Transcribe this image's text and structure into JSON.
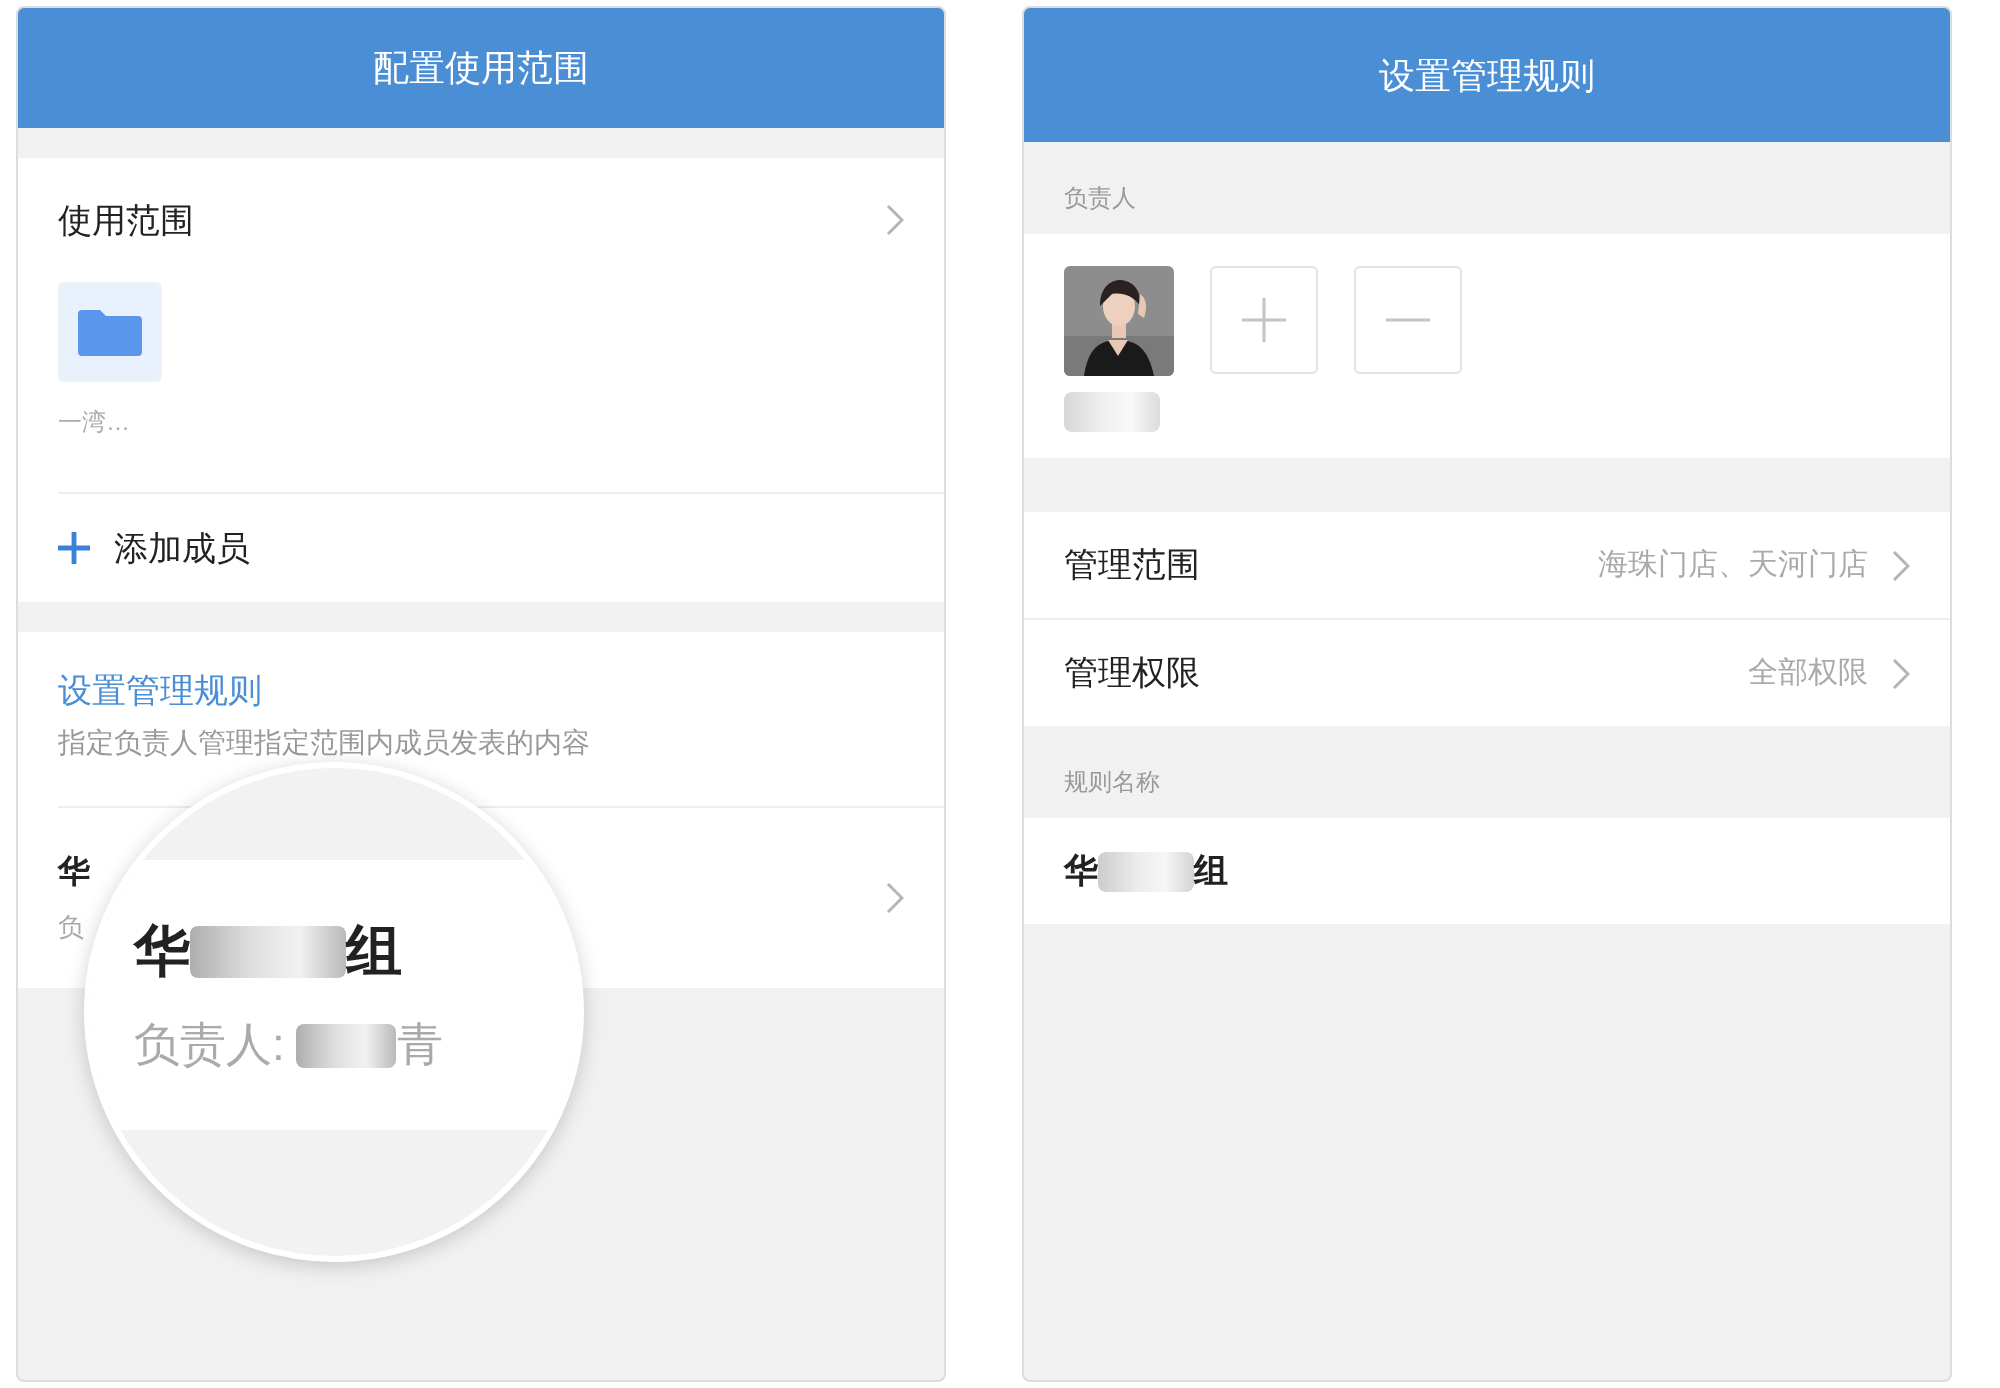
{
  "left_screen": {
    "title": "配置使用范围",
    "scope": {
      "label": "使用范围",
      "folder_caption": "一湾…"
    },
    "add_member": "添加成员",
    "rule": {
      "title": "设置管理规则",
      "description": "指定负责人管理指定范围内成员发表的内容"
    },
    "rule_item": {
      "name_start": "华",
      "owner_start": "负"
    },
    "magnifier": {
      "name_start": "华",
      "name_end": "组",
      "owner_label": "负责人:",
      "owner_end": "青"
    }
  },
  "right_screen": {
    "title": "设置管理规则",
    "owner_section": "负责人",
    "rows": [
      {
        "label": "管理范围",
        "value": "海珠门店、天河门店"
      },
      {
        "label": "管理权限",
        "value": "全部权限"
      }
    ],
    "rule_name_section": "规则名称",
    "rule_name": {
      "start": "华",
      "end": "组"
    }
  }
}
